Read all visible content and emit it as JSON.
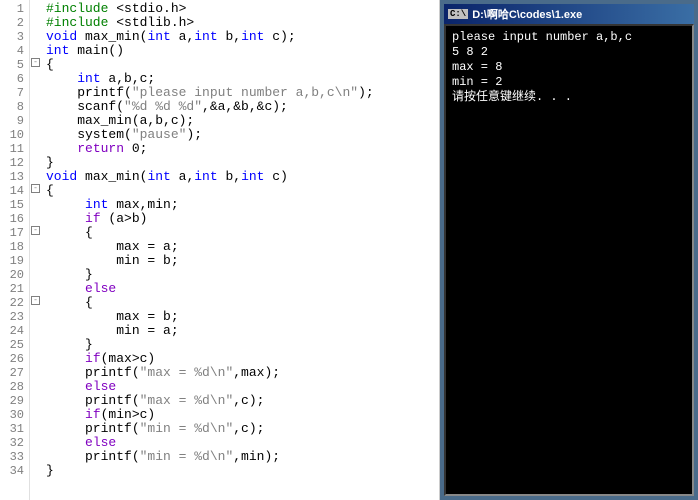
{
  "code_lines": [
    {
      "n": 1,
      "fold": null,
      "tokens": [
        {
          "c": "kw-green",
          "t": "#include "
        },
        {
          "c": "",
          "t": "<stdio.h>"
        }
      ]
    },
    {
      "n": 2,
      "fold": null,
      "tokens": [
        {
          "c": "kw-green",
          "t": "#include "
        },
        {
          "c": "",
          "t": "<stdlib.h>"
        }
      ]
    },
    {
      "n": 3,
      "fold": null,
      "tokens": [
        {
          "c": "kw-blue",
          "t": "void"
        },
        {
          "c": "",
          "t": " max_min("
        },
        {
          "c": "kw-blue",
          "t": "int"
        },
        {
          "c": "",
          "t": " a,"
        },
        {
          "c": "kw-blue",
          "t": "int"
        },
        {
          "c": "",
          "t": " b,"
        },
        {
          "c": "kw-blue",
          "t": "int"
        },
        {
          "c": "",
          "t": " c);"
        }
      ]
    },
    {
      "n": 4,
      "fold": null,
      "tokens": [
        {
          "c": "kw-blue",
          "t": "int"
        },
        {
          "c": "",
          "t": " main()"
        }
      ]
    },
    {
      "n": 5,
      "fold": "open",
      "tokens": [
        {
          "c": "",
          "t": "{"
        }
      ]
    },
    {
      "n": 6,
      "fold": null,
      "tokens": [
        {
          "c": "",
          "t": "    "
        },
        {
          "c": "kw-blue",
          "t": "int"
        },
        {
          "c": "",
          "t": " a,b,c;"
        }
      ]
    },
    {
      "n": 7,
      "fold": null,
      "tokens": [
        {
          "c": "",
          "t": "    printf("
        },
        {
          "c": "str",
          "t": "\"please input number a,b,c\\n\""
        },
        {
          "c": "",
          "t": ");"
        }
      ]
    },
    {
      "n": 8,
      "fold": null,
      "tokens": [
        {
          "c": "",
          "t": "    scanf("
        },
        {
          "c": "str",
          "t": "\"%d %d %d\""
        },
        {
          "c": "",
          "t": ",&a,&b,&c);"
        }
      ]
    },
    {
      "n": 9,
      "fold": null,
      "tokens": [
        {
          "c": "",
          "t": "    max_min(a,b,c);"
        }
      ]
    },
    {
      "n": 10,
      "fold": null,
      "tokens": [
        {
          "c": "",
          "t": "    system("
        },
        {
          "c": "str",
          "t": "\"pause\""
        },
        {
          "c": "",
          "t": ");"
        }
      ]
    },
    {
      "n": 11,
      "fold": null,
      "tokens": [
        {
          "c": "",
          "t": "    "
        },
        {
          "c": "kw-purple",
          "t": "return"
        },
        {
          "c": "",
          "t": " 0;"
        }
      ]
    },
    {
      "n": 12,
      "fold": null,
      "tokens": [
        {
          "c": "",
          "t": "}"
        }
      ]
    },
    {
      "n": 13,
      "fold": null,
      "tokens": [
        {
          "c": "kw-blue",
          "t": "void"
        },
        {
          "c": "",
          "t": " max_min("
        },
        {
          "c": "kw-blue",
          "t": "int"
        },
        {
          "c": "",
          "t": " a,"
        },
        {
          "c": "kw-blue",
          "t": "int"
        },
        {
          "c": "",
          "t": " b,"
        },
        {
          "c": "kw-blue",
          "t": "int"
        },
        {
          "c": "",
          "t": " c)"
        }
      ]
    },
    {
      "n": 14,
      "fold": "open",
      "tokens": [
        {
          "c": "",
          "t": "{"
        }
      ]
    },
    {
      "n": 15,
      "fold": null,
      "tokens": [
        {
          "c": "",
          "t": "     "
        },
        {
          "c": "kw-blue",
          "t": "int"
        },
        {
          "c": "",
          "t": " max,min;"
        }
      ]
    },
    {
      "n": 16,
      "fold": null,
      "tokens": [
        {
          "c": "",
          "t": "     "
        },
        {
          "c": "kw-purple",
          "t": "if"
        },
        {
          "c": "",
          "t": " (a>b)"
        }
      ]
    },
    {
      "n": 17,
      "fold": "open",
      "tokens": [
        {
          "c": "",
          "t": "     {"
        }
      ]
    },
    {
      "n": 18,
      "fold": null,
      "tokens": [
        {
          "c": "",
          "t": "         max = a;"
        }
      ]
    },
    {
      "n": 19,
      "fold": null,
      "tokens": [
        {
          "c": "",
          "t": "         min = b;"
        }
      ]
    },
    {
      "n": 20,
      "fold": null,
      "tokens": [
        {
          "c": "",
          "t": "     }"
        }
      ]
    },
    {
      "n": 21,
      "fold": null,
      "tokens": [
        {
          "c": "",
          "t": "     "
        },
        {
          "c": "kw-purple",
          "t": "else"
        }
      ]
    },
    {
      "n": 22,
      "fold": "open",
      "tokens": [
        {
          "c": "",
          "t": "     {"
        }
      ]
    },
    {
      "n": 23,
      "fold": null,
      "tokens": [
        {
          "c": "",
          "t": "         max = b;"
        }
      ]
    },
    {
      "n": 24,
      "fold": null,
      "tokens": [
        {
          "c": "",
          "t": "         min = a;"
        }
      ]
    },
    {
      "n": 25,
      "fold": null,
      "tokens": [
        {
          "c": "",
          "t": "     }"
        }
      ]
    },
    {
      "n": 26,
      "fold": null,
      "tokens": [
        {
          "c": "",
          "t": "     "
        },
        {
          "c": "kw-purple",
          "t": "if"
        },
        {
          "c": "",
          "t": "(max>c)"
        }
      ]
    },
    {
      "n": 27,
      "fold": null,
      "tokens": [
        {
          "c": "",
          "t": "     printf("
        },
        {
          "c": "str",
          "t": "\"max = %d\\n\""
        },
        {
          "c": "",
          "t": ",max);"
        }
      ]
    },
    {
      "n": 28,
      "fold": null,
      "tokens": [
        {
          "c": "",
          "t": "     "
        },
        {
          "c": "kw-purple",
          "t": "else"
        }
      ]
    },
    {
      "n": 29,
      "fold": null,
      "tokens": [
        {
          "c": "",
          "t": "     printf("
        },
        {
          "c": "str",
          "t": "\"max = %d\\n\""
        },
        {
          "c": "",
          "t": ",c);"
        }
      ]
    },
    {
      "n": 30,
      "fold": null,
      "tokens": [
        {
          "c": "",
          "t": "     "
        },
        {
          "c": "kw-purple",
          "t": "if"
        },
        {
          "c": "",
          "t": "(min>c)"
        }
      ]
    },
    {
      "n": 31,
      "fold": null,
      "tokens": [
        {
          "c": "",
          "t": "     printf("
        },
        {
          "c": "str",
          "t": "\"min = %d\\n\""
        },
        {
          "c": "",
          "t": ",c);"
        }
      ]
    },
    {
      "n": 32,
      "fold": null,
      "tokens": [
        {
          "c": "",
          "t": "     "
        },
        {
          "c": "kw-purple",
          "t": "else"
        }
      ]
    },
    {
      "n": 33,
      "fold": null,
      "tokens": [
        {
          "c": "",
          "t": "     printf("
        },
        {
          "c": "str",
          "t": "\"min = %d\\n\""
        },
        {
          "c": "",
          "t": ",min);"
        }
      ]
    },
    {
      "n": 34,
      "fold": null,
      "tokens": [
        {
          "c": "",
          "t": "}"
        }
      ]
    }
  ],
  "console": {
    "icon_text": "C:\\",
    "title": "D:\\啊哈C\\codes\\1.exe",
    "lines": [
      "please input number a,b,c",
      "5 8 2",
      "max = 8",
      "min = 2",
      "请按任意键继续. . ."
    ]
  }
}
